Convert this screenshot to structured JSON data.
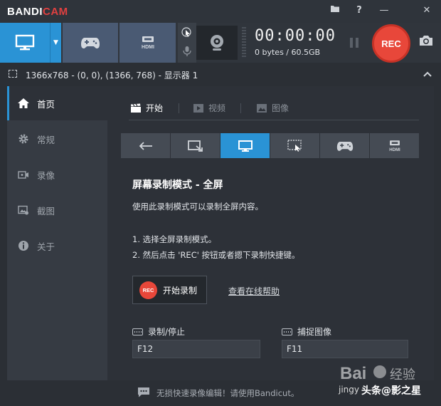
{
  "app": {
    "logo_part1": "BANDI",
    "logo_part2": "CAM"
  },
  "titlebar": {
    "buttons": [
      "folder-icon",
      "help-icon",
      "minimize-icon",
      "close-icon"
    ],
    "help_label": "?",
    "minimize_label": "—",
    "close_label": "✕"
  },
  "toolbar": {
    "modes": [
      "screen-mode",
      "game-mode",
      "hdmi-mode"
    ],
    "dropdown_label": "▼",
    "timer": "00:00:00",
    "file_size": "0 bytes / 60.5GB",
    "rec_label": "REC"
  },
  "area": {
    "text": "1366x768 - (0, 0), (1366, 768) - 显示器 1"
  },
  "sidebar": {
    "items": [
      {
        "label": "首页",
        "icon": "home-icon",
        "active": true
      },
      {
        "label": "常规",
        "icon": "gear-icon",
        "active": false
      },
      {
        "label": "录像",
        "icon": "video-settings-icon",
        "active": false
      },
      {
        "label": "截图",
        "icon": "image-settings-icon",
        "active": false
      },
      {
        "label": "关于",
        "icon": "info-icon",
        "active": false
      }
    ]
  },
  "main": {
    "tabs": [
      {
        "label": "开始",
        "icon": "clapper-icon",
        "active": true
      },
      {
        "label": "视频",
        "icon": "play-icon",
        "active": false
      },
      {
        "label": "图像",
        "icon": "picture-icon",
        "active": false
      }
    ],
    "record_modes": [
      "back-arrow-icon",
      "rectangle-mode-icon",
      "fullscreen-mode-icon",
      "around-mouse-icon",
      "game-mode-icon",
      "hdmi-mode-icon"
    ],
    "active_mode_index": 2,
    "heading": "屏幕录制模式 - 全屏",
    "description": "使用此录制模式可以录制全屏内容。",
    "step1": "1. 选择全屏录制模式。",
    "step2": "2. 然后点击 'REC' 按钮或者摁下录制快捷键。",
    "start_button_badge": "REC",
    "start_button_label": "开始录制",
    "help_link": "查看在线帮助",
    "hotkeys": {
      "record_label": "录制/停止",
      "record_value": "F12",
      "capture_label": "捕捉图像",
      "capture_value": "F11"
    }
  },
  "footer": {
    "text": "无损快速录像编辑！请使用Bandicut。"
  },
  "watermark": {
    "site": "jingy",
    "author": "头条@影之星"
  },
  "colors": {
    "accent": "#2a93d5",
    "rec": "#e8473a",
    "tile": "#4a5a73"
  }
}
